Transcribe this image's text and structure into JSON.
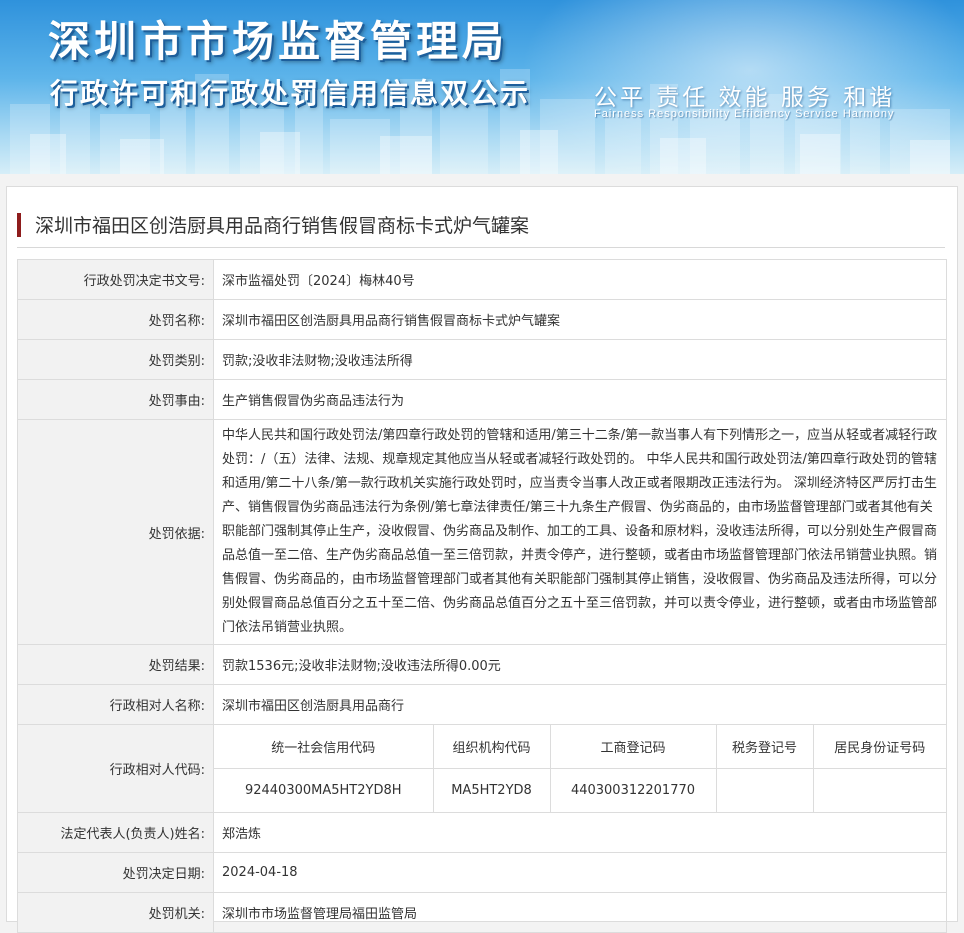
{
  "banner": {
    "title": "深圳市市场监督管理局",
    "subtitle": "行政许可和行政处罚信用信息双公示",
    "slogan": "公平  责任  效能  服务  和谐",
    "slogan_en": "Fairness  Responsibility  Efficiency  Service  Harmony"
  },
  "case": {
    "title": "深圳市福田区创浩厨具用品商行销售假冒商标卡式炉气罐案"
  },
  "fields": {
    "decision_no": {
      "label": "行政处罚决定书文号:",
      "value": "深市监福处罚〔2024〕梅林40号"
    },
    "penalty_name": {
      "label": "处罚名称:",
      "value": "深圳市福田区创浩厨具用品商行销售假冒商标卡式炉气罐案"
    },
    "penalty_type": {
      "label": "处罚类别:",
      "value": "罚款;没收非法财物;没收违法所得"
    },
    "penalty_reason": {
      "label": "处罚事由:",
      "value": "生产销售假冒伪劣商品违法行为"
    },
    "penalty_basis": {
      "label": "处罚依据:",
      "value": "中华人民共和国行政处罚法/第四章行政处罚的管辖和适用/第三十二条/第一款当事人有下列情形之一，应当从轻或者减轻行政处罚：/（五）法律、法规、规章规定其他应当从轻或者减轻行政处罚的。 中华人民共和国行政处罚法/第四章行政处罚的管辖和适用/第二十八条/第一款行政机关实施行政处罚时，应当责令当事人改正或者限期改正违法行为。 深圳经济特区严厉打击生产、销售假冒伪劣商品违法行为条例/第七章法律责任/第三十九条生产假冒、伪劣商品的，由市场监督管理部门或者其他有关职能部门强制其停止生产，没收假冒、伪劣商品及制作、加工的工具、设备和原材料，没收违法所得，可以分别处生产假冒商品总值一至二倍、生产伪劣商品总值一至三倍罚款，并责令停产，进行整顿，或者由市场监督管理部门依法吊销营业执照。销售假冒、伪劣商品的，由市场监督管理部门或者其他有关职能部门强制其停止销售，没收假冒、伪劣商品及违法所得，可以分别处假冒商品总值百分之五十至二倍、伪劣商品总值百分之五十至三倍罚款，并可以责令停业，进行整顿，或者由市场监管部门依法吊销营业执照。"
    },
    "penalty_result": {
      "label": "处罚结果:",
      "value": "罚款1536元;没收非法财物;没收违法所得0.00元"
    },
    "party_name": {
      "label": "行政相对人名称:",
      "value": "深圳市福田区创浩厨具用品商行"
    },
    "party_code": {
      "label": "行政相对人代码:",
      "headers": [
        "统一社会信用代码",
        "组织机构代码",
        "工商登记码",
        "税务登记号",
        "居民身份证号码"
      ],
      "values": [
        "92440300MA5HT2YD8H",
        "MA5HT2YD8",
        "440300312201770",
        "",
        ""
      ]
    },
    "legal_rep": {
      "label": "法定代表人(负责人)姓名:",
      "value": "郑浩炼"
    },
    "decision_date": {
      "label": "处罚决定日期:",
      "value": "2024-04-18"
    },
    "authority": {
      "label": "处罚机关:",
      "value": "深圳市市场监督管理局福田监管局"
    }
  }
}
